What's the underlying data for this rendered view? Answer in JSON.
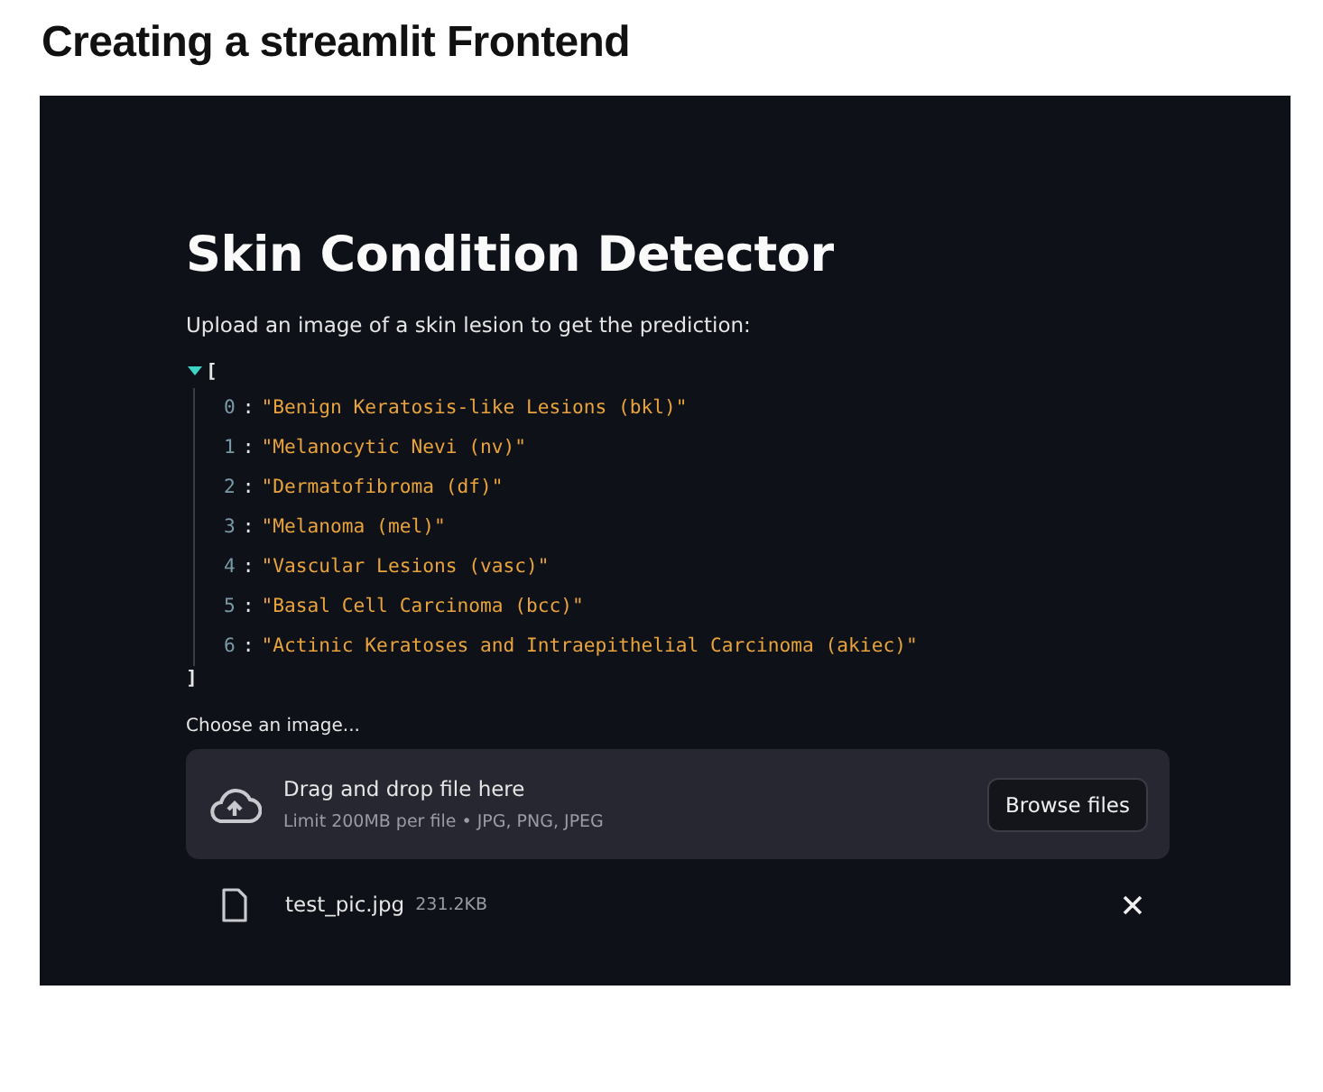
{
  "page_title": "Creating a streamlit Frontend",
  "app": {
    "title": "Skin Condition Detector",
    "prompt": "Upload an image of a skin lesion to get the prediction:",
    "json_view": {
      "expanded": true,
      "open_bracket": "[",
      "close_bracket": "]",
      "items": [
        {
          "index": "0",
          "separator": ":",
          "value": "\"Benign Keratosis-like Lesions (bkl)\""
        },
        {
          "index": "1",
          "separator": ":",
          "value": "\"Melanocytic Nevi (nv)\""
        },
        {
          "index": "2",
          "separator": ":",
          "value": "\"Dermatofibroma (df)\""
        },
        {
          "index": "3",
          "separator": ":",
          "value": "\"Melanoma (mel)\""
        },
        {
          "index": "4",
          "separator": ":",
          "value": "\"Vascular Lesions (vasc)\""
        },
        {
          "index": "5",
          "separator": ":",
          "value": "\"Basal Cell Carcinoma (bcc)\""
        },
        {
          "index": "6",
          "separator": ":",
          "value": "\"Actinic Keratoses and Intraepithelial Carcinoma (akiec)\""
        }
      ]
    },
    "uploader": {
      "label": "Choose an image...",
      "dropzone_title": "Drag and drop file here",
      "dropzone_hint": "Limit 200MB per file • JPG, PNG, JPEG",
      "button": "Browse files",
      "file": {
        "name": "test_pic.jpg",
        "size": "231.2KB"
      }
    }
  }
}
